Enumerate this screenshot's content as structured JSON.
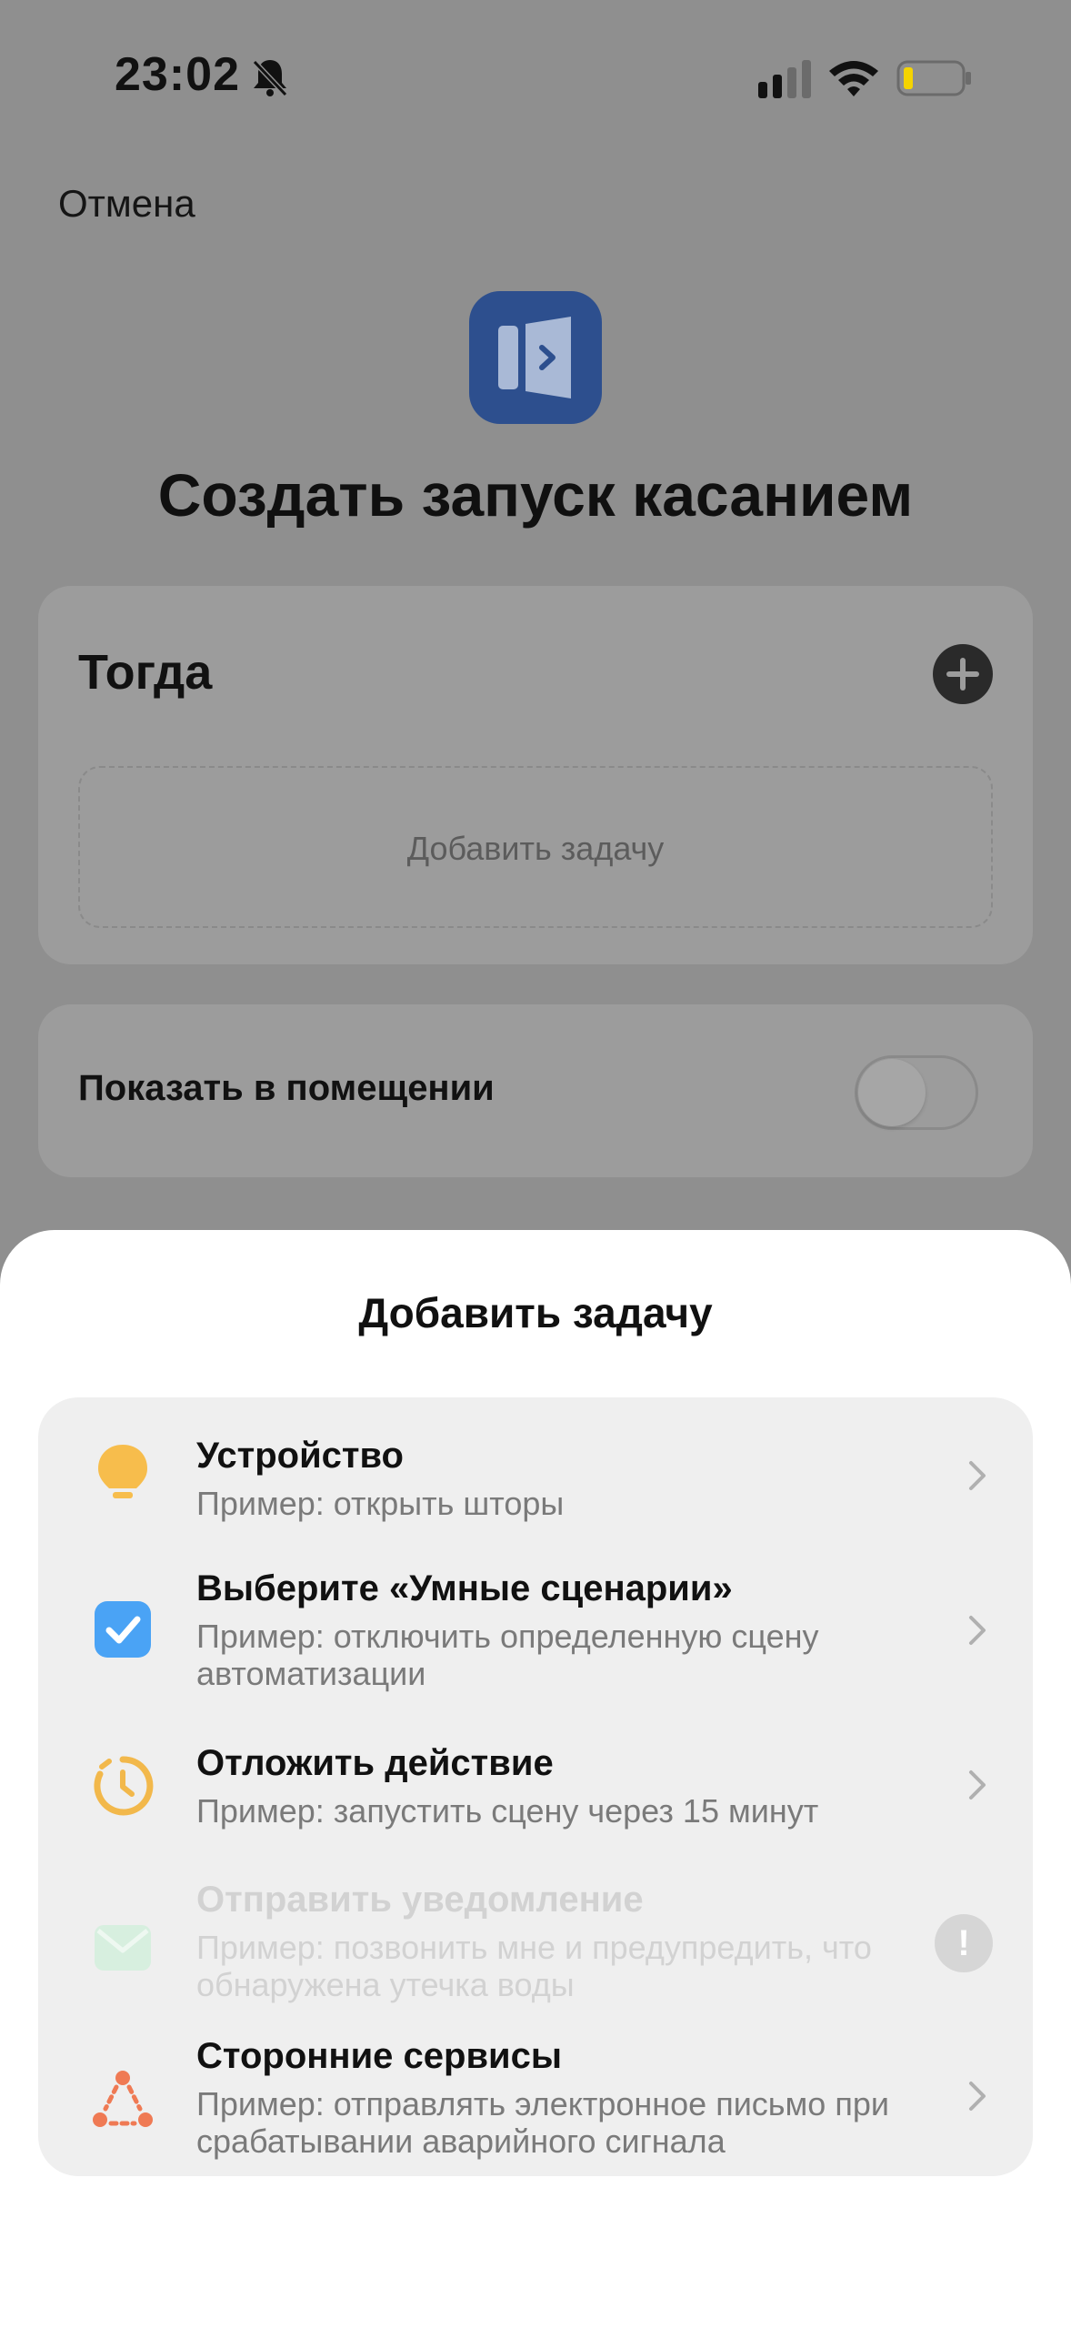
{
  "status_bar": {
    "time": "23:02",
    "icons": [
      "bell-off-icon",
      "cellular-signal-icon",
      "wifi-icon",
      "battery-low-icon"
    ],
    "battery_color": "#f5d400"
  },
  "header": {
    "cancel_label": "Отмена",
    "app_icon": "scene-panel-icon",
    "title": "Создать запуск касанием"
  },
  "then_card": {
    "label": "Тогда",
    "add_icon": "plus-icon",
    "placeholder": "Добавить задачу"
  },
  "room_card": {
    "label": "Показать в помещении",
    "toggle_on": false
  },
  "sheet": {
    "title": "Добавить задачу",
    "items": [
      {
        "icon": "lightbulb-icon",
        "title": "Устройство",
        "subtitle": "Пример: открыть шторы",
        "enabled": true
      },
      {
        "icon": "checkbox-icon",
        "title": "Выберите «Умные сценарии»",
        "subtitle": "Пример: отключить определенную сцену автоматизации",
        "enabled": true
      },
      {
        "icon": "timer-icon",
        "title": "Отложить действие",
        "subtitle": "Пример: запустить сцену через 15 минут",
        "enabled": true
      },
      {
        "icon": "envelope-icon",
        "title": "Отправить уведомление",
        "subtitle": "Пример: позвонить мне и предупредить, что обнаружена утечка воды",
        "enabled": false,
        "badge": "!"
      },
      {
        "icon": "integration-icon",
        "title": "Сторонние сервисы",
        "subtitle": "Пример: отправлять электронное письмо при срабатывании аварийного сигнала",
        "enabled": true
      }
    ]
  },
  "colors": {
    "overlay": "#8f8f8f",
    "app_icon_bg": "#2d4f8e",
    "bulb": "#f7bd4c",
    "check": "#4aa3f5",
    "timer": "#f2b84b",
    "envelope_disabled": "#d7efdf",
    "integration": "#ef7a54"
  }
}
